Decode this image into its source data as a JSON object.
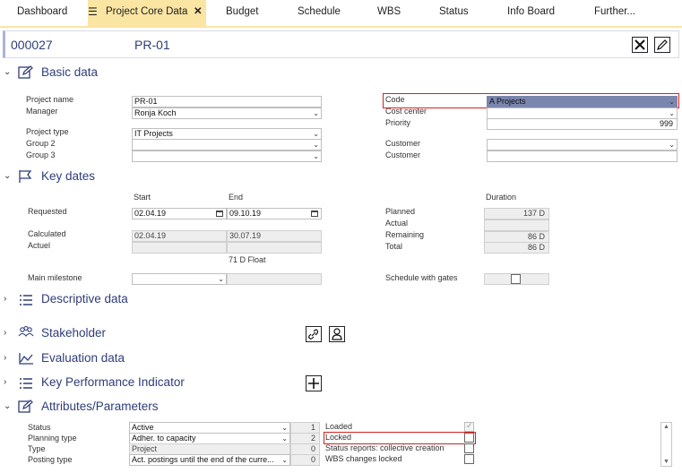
{
  "tabs": [
    {
      "label": "Dashboard"
    },
    {
      "label": "Project Core Data",
      "close": "✕"
    },
    {
      "label": "Budget"
    },
    {
      "label": "Schedule"
    },
    {
      "label": "WBS"
    },
    {
      "label": "Status"
    },
    {
      "label": "Info Board"
    },
    {
      "label": "Further..."
    }
  ],
  "header": {
    "id": "000027",
    "code": "PR-01"
  },
  "sections": {
    "basic": "Basic data",
    "keydates": "Key dates",
    "descriptive": "Descriptive data",
    "stakeholder": "Stakeholder",
    "evaluation": "Evaluation data",
    "kpi": "Key Performance Indicator",
    "attributes": "Attributes/Parameters"
  },
  "basic": {
    "project_name_label": "Project name",
    "project_name": "PR-01",
    "manager_label": "Manager",
    "manager": "Ronja Koch",
    "project_type_label": "Project type",
    "project_type": "IT Projects",
    "group2_label": "Group 2",
    "group2": "",
    "group3_label": "Group 3",
    "group3": "",
    "code_label": "Code",
    "code": "A Projects",
    "cost_center_label": "Cost center",
    "cost_center": "",
    "priority_label": "Priority",
    "priority": "999",
    "customer1_label": "Customer",
    "customer1": "",
    "customer2_label": "Customer",
    "customer2": ""
  },
  "keydates": {
    "start_header": "Start",
    "end_header": "End",
    "duration_header": "Duration",
    "requested_label": "Requested",
    "requested_start": "02.04.19",
    "requested_end": "09.10.19",
    "calculated_label": "Calculated",
    "calculated_start": "02.04.19",
    "calculated_end": "30.07.19",
    "actual_label": "Actuel",
    "float": "71 D Float",
    "main_milestone_label": "Main milestone",
    "planned_label": "Planned",
    "planned": "137 D",
    "actual2_label": "Actual",
    "actual2": "",
    "remaining_label": "Remaining",
    "remaining": "86 D",
    "total_label": "Total",
    "total": "86 D",
    "gates_label": "Schedule with gates"
  },
  "attributes": {
    "rows": [
      {
        "label": "Status",
        "value": "Active",
        "num": "1"
      },
      {
        "label": "Planning type",
        "value": "Adher. to capacity",
        "num": "2"
      },
      {
        "label": "Type",
        "value": "Project",
        "num": "0"
      },
      {
        "label": "Posting type",
        "value": "Act. postings until the end of the curre...",
        "num": "0"
      }
    ],
    "checks": [
      {
        "label": "Loaded",
        "checked": true
      },
      {
        "label": "Locked",
        "checked": false
      },
      {
        "label": "Status reports: collective creation",
        "checked": false
      },
      {
        "label": "WBS changes locked",
        "checked": false
      }
    ]
  },
  "colors": {
    "accent_tab": "#fbe5a3",
    "title_blue": "#2f3d7a",
    "highlight": "#d62020",
    "code_selected": "#7a86ad"
  }
}
